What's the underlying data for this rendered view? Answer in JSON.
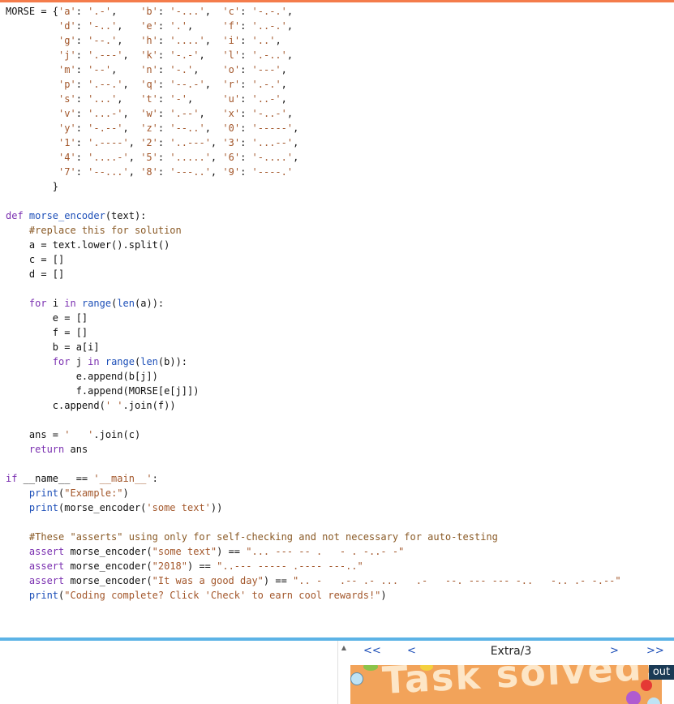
{
  "editor": {
    "lines": [
      [
        {
          "t": "MORSE = {",
          "c": ""
        },
        {
          "t": "'a'",
          "c": "str"
        },
        {
          "t": ": ",
          "c": ""
        },
        {
          "t": "'.-'",
          "c": "str"
        },
        {
          "t": ",    ",
          "c": ""
        },
        {
          "t": "'b'",
          "c": "str"
        },
        {
          "t": ": ",
          "c": ""
        },
        {
          "t": "'-...'",
          "c": "str"
        },
        {
          "t": ",  ",
          "c": ""
        },
        {
          "t": "'c'",
          "c": "str"
        },
        {
          "t": ": ",
          "c": ""
        },
        {
          "t": "'-.-.'",
          "c": "str"
        },
        {
          "t": ",",
          "c": ""
        }
      ],
      [
        {
          "t": "         ",
          "c": ""
        },
        {
          "t": "'d'",
          "c": "str"
        },
        {
          "t": ": ",
          "c": ""
        },
        {
          "t": "'-..'",
          "c": "str"
        },
        {
          "t": ",   ",
          "c": ""
        },
        {
          "t": "'e'",
          "c": "str"
        },
        {
          "t": ": ",
          "c": ""
        },
        {
          "t": "'.'",
          "c": "str"
        },
        {
          "t": ",     ",
          "c": ""
        },
        {
          "t": "'f'",
          "c": "str"
        },
        {
          "t": ": ",
          "c": ""
        },
        {
          "t": "'..-.'",
          "c": "str"
        },
        {
          "t": ",",
          "c": ""
        }
      ],
      [
        {
          "t": "         ",
          "c": ""
        },
        {
          "t": "'g'",
          "c": "str"
        },
        {
          "t": ": ",
          "c": ""
        },
        {
          "t": "'--.'",
          "c": "str"
        },
        {
          "t": ",   ",
          "c": ""
        },
        {
          "t": "'h'",
          "c": "str"
        },
        {
          "t": ": ",
          "c": ""
        },
        {
          "t": "'....'",
          "c": "str"
        },
        {
          "t": ",  ",
          "c": ""
        },
        {
          "t": "'i'",
          "c": "str"
        },
        {
          "t": ": ",
          "c": ""
        },
        {
          "t": "'..'",
          "c": "str"
        },
        {
          "t": ",",
          "c": ""
        }
      ],
      [
        {
          "t": "         ",
          "c": ""
        },
        {
          "t": "'j'",
          "c": "str"
        },
        {
          "t": ": ",
          "c": ""
        },
        {
          "t": "'.---'",
          "c": "str"
        },
        {
          "t": ",  ",
          "c": ""
        },
        {
          "t": "'k'",
          "c": "str"
        },
        {
          "t": ": ",
          "c": ""
        },
        {
          "t": "'-.-'",
          "c": "str"
        },
        {
          "t": ",   ",
          "c": ""
        },
        {
          "t": "'l'",
          "c": "str"
        },
        {
          "t": ": ",
          "c": ""
        },
        {
          "t": "'.-..'",
          "c": "str"
        },
        {
          "t": ",",
          "c": ""
        }
      ],
      [
        {
          "t": "         ",
          "c": ""
        },
        {
          "t": "'m'",
          "c": "str"
        },
        {
          "t": ": ",
          "c": ""
        },
        {
          "t": "'--'",
          "c": "str"
        },
        {
          "t": ",    ",
          "c": ""
        },
        {
          "t": "'n'",
          "c": "str"
        },
        {
          "t": ": ",
          "c": ""
        },
        {
          "t": "'-.'",
          "c": "str"
        },
        {
          "t": ",    ",
          "c": ""
        },
        {
          "t": "'o'",
          "c": "str"
        },
        {
          "t": ": ",
          "c": ""
        },
        {
          "t": "'---'",
          "c": "str"
        },
        {
          "t": ",",
          "c": ""
        }
      ],
      [
        {
          "t": "         ",
          "c": ""
        },
        {
          "t": "'p'",
          "c": "str"
        },
        {
          "t": ": ",
          "c": ""
        },
        {
          "t": "'.--.'",
          "c": "str"
        },
        {
          "t": ",  ",
          "c": ""
        },
        {
          "t": "'q'",
          "c": "str"
        },
        {
          "t": ": ",
          "c": ""
        },
        {
          "t": "'--.-'",
          "c": "str"
        },
        {
          "t": ",  ",
          "c": ""
        },
        {
          "t": "'r'",
          "c": "str"
        },
        {
          "t": ": ",
          "c": ""
        },
        {
          "t": "'.-.'",
          "c": "str"
        },
        {
          "t": ",",
          "c": ""
        }
      ],
      [
        {
          "t": "         ",
          "c": ""
        },
        {
          "t": "'s'",
          "c": "str"
        },
        {
          "t": ": ",
          "c": ""
        },
        {
          "t": "'...'",
          "c": "str"
        },
        {
          "t": ",   ",
          "c": ""
        },
        {
          "t": "'t'",
          "c": "str"
        },
        {
          "t": ": ",
          "c": ""
        },
        {
          "t": "'-'",
          "c": "str"
        },
        {
          "t": ",     ",
          "c": ""
        },
        {
          "t": "'u'",
          "c": "str"
        },
        {
          "t": ": ",
          "c": ""
        },
        {
          "t": "'..-'",
          "c": "str"
        },
        {
          "t": ",",
          "c": ""
        }
      ],
      [
        {
          "t": "         ",
          "c": ""
        },
        {
          "t": "'v'",
          "c": "str"
        },
        {
          "t": ": ",
          "c": ""
        },
        {
          "t": "'...-'",
          "c": "str"
        },
        {
          "t": ",  ",
          "c": ""
        },
        {
          "t": "'w'",
          "c": "str"
        },
        {
          "t": ": ",
          "c": ""
        },
        {
          "t": "'.--'",
          "c": "str"
        },
        {
          "t": ",   ",
          "c": ""
        },
        {
          "t": "'x'",
          "c": "str"
        },
        {
          "t": ": ",
          "c": ""
        },
        {
          "t": "'-..-'",
          "c": "str"
        },
        {
          "t": ",",
          "c": ""
        }
      ],
      [
        {
          "t": "         ",
          "c": ""
        },
        {
          "t": "'y'",
          "c": "str"
        },
        {
          "t": ": ",
          "c": ""
        },
        {
          "t": "'-.--'",
          "c": "str"
        },
        {
          "t": ",  ",
          "c": ""
        },
        {
          "t": "'z'",
          "c": "str"
        },
        {
          "t": ": ",
          "c": ""
        },
        {
          "t": "'--..'",
          "c": "str"
        },
        {
          "t": ",  ",
          "c": ""
        },
        {
          "t": "'0'",
          "c": "str"
        },
        {
          "t": ": ",
          "c": ""
        },
        {
          "t": "'-----'",
          "c": "str"
        },
        {
          "t": ",",
          "c": ""
        }
      ],
      [
        {
          "t": "         ",
          "c": ""
        },
        {
          "t": "'1'",
          "c": "str"
        },
        {
          "t": ": ",
          "c": ""
        },
        {
          "t": "'.----'",
          "c": "str"
        },
        {
          "t": ", ",
          "c": ""
        },
        {
          "t": "'2'",
          "c": "str"
        },
        {
          "t": ": ",
          "c": ""
        },
        {
          "t": "'..---'",
          "c": "str"
        },
        {
          "t": ", ",
          "c": ""
        },
        {
          "t": "'3'",
          "c": "str"
        },
        {
          "t": ": ",
          "c": ""
        },
        {
          "t": "'...--'",
          "c": "str"
        },
        {
          "t": ",",
          "c": ""
        }
      ],
      [
        {
          "t": "         ",
          "c": ""
        },
        {
          "t": "'4'",
          "c": "str"
        },
        {
          "t": ": ",
          "c": ""
        },
        {
          "t": "'....-'",
          "c": "str"
        },
        {
          "t": ", ",
          "c": ""
        },
        {
          "t": "'5'",
          "c": "str"
        },
        {
          "t": ": ",
          "c": ""
        },
        {
          "t": "'.....'",
          "c": "str"
        },
        {
          "t": ", ",
          "c": ""
        },
        {
          "t": "'6'",
          "c": "str"
        },
        {
          "t": ": ",
          "c": ""
        },
        {
          "t": "'-....'",
          "c": "str"
        },
        {
          "t": ",",
          "c": ""
        }
      ],
      [
        {
          "t": "         ",
          "c": ""
        },
        {
          "t": "'7'",
          "c": "str"
        },
        {
          "t": ": ",
          "c": ""
        },
        {
          "t": "'--...'",
          "c": "str"
        },
        {
          "t": ", ",
          "c": ""
        },
        {
          "t": "'8'",
          "c": "str"
        },
        {
          "t": ": ",
          "c": ""
        },
        {
          "t": "'---..'",
          "c": "str"
        },
        {
          "t": ", ",
          "c": ""
        },
        {
          "t": "'9'",
          "c": "str"
        },
        {
          "t": ": ",
          "c": ""
        },
        {
          "t": "'----.'",
          "c": "str"
        }
      ],
      [
        {
          "t": "        }",
          "c": ""
        }
      ],
      [],
      [
        {
          "t": "def ",
          "c": "kw"
        },
        {
          "t": "morse_encoder",
          "c": "fn"
        },
        {
          "t": "(text):",
          "c": ""
        }
      ],
      [
        {
          "t": "    ",
          "c": ""
        },
        {
          "t": "#replace this for solution",
          "c": "cm"
        }
      ],
      [
        {
          "t": "    a = text.lower().split()",
          "c": ""
        }
      ],
      [
        {
          "t": "    c = []",
          "c": ""
        }
      ],
      [
        {
          "t": "    d = []",
          "c": ""
        }
      ],
      [],
      [
        {
          "t": "    ",
          "c": ""
        },
        {
          "t": "for",
          "c": "kw"
        },
        {
          "t": " i ",
          "c": ""
        },
        {
          "t": "in",
          "c": "kw"
        },
        {
          "t": " ",
          "c": ""
        },
        {
          "t": "range",
          "c": "fn"
        },
        {
          "t": "(",
          "c": ""
        },
        {
          "t": "len",
          "c": "fn"
        },
        {
          "t": "(a)):",
          "c": ""
        }
      ],
      [
        {
          "t": "        e = []",
          "c": ""
        }
      ],
      [
        {
          "t": "        f = []",
          "c": ""
        }
      ],
      [
        {
          "t": "        b = a[i]",
          "c": ""
        }
      ],
      [
        {
          "t": "        ",
          "c": ""
        },
        {
          "t": "for",
          "c": "kw"
        },
        {
          "t": " j ",
          "c": ""
        },
        {
          "t": "in",
          "c": "kw"
        },
        {
          "t": " ",
          "c": ""
        },
        {
          "t": "range",
          "c": "fn"
        },
        {
          "t": "(",
          "c": ""
        },
        {
          "t": "len",
          "c": "fn"
        },
        {
          "t": "(b)):",
          "c": ""
        }
      ],
      [
        {
          "t": "            e.append(b[j])",
          "c": ""
        }
      ],
      [
        {
          "t": "            f.append(MORSE[e[j]])",
          "c": ""
        }
      ],
      [
        {
          "t": "        c.append(",
          "c": ""
        },
        {
          "t": "' '",
          "c": "str"
        },
        {
          "t": ".join(f))",
          "c": ""
        }
      ],
      [],
      [
        {
          "t": "    ans = ",
          "c": ""
        },
        {
          "t": "'   '",
          "c": "str"
        },
        {
          "t": ".join(c)",
          "c": ""
        }
      ],
      [
        {
          "t": "    ",
          "c": ""
        },
        {
          "t": "return",
          "c": "kw"
        },
        {
          "t": " ans",
          "c": ""
        }
      ],
      [],
      [
        {
          "t": "if",
          "c": "kw"
        },
        {
          "t": " __name__ == ",
          "c": ""
        },
        {
          "t": "'__main__'",
          "c": "str"
        },
        {
          "t": ":",
          "c": ""
        }
      ],
      [
        {
          "t": "    ",
          "c": ""
        },
        {
          "t": "print",
          "c": "fn"
        },
        {
          "t": "(",
          "c": ""
        },
        {
          "t": "\"Example:\"",
          "c": "str"
        },
        {
          "t": ")",
          "c": ""
        }
      ],
      [
        {
          "t": "    ",
          "c": ""
        },
        {
          "t": "print",
          "c": "fn"
        },
        {
          "t": "(morse_encoder(",
          "c": ""
        },
        {
          "t": "'some text'",
          "c": "str"
        },
        {
          "t": "))",
          "c": ""
        }
      ],
      [],
      [
        {
          "t": "    ",
          "c": ""
        },
        {
          "t": "#These \"asserts\" using only for self-checking and not necessary for auto-testing",
          "c": "cm"
        }
      ],
      [
        {
          "t": "    ",
          "c": ""
        },
        {
          "t": "assert",
          "c": "kw"
        },
        {
          "t": " morse_encoder(",
          "c": ""
        },
        {
          "t": "\"some text\"",
          "c": "str"
        },
        {
          "t": ") == ",
          "c": ""
        },
        {
          "t": "\"... --- -- .   - . -..- -\"",
          "c": "str"
        }
      ],
      [
        {
          "t": "    ",
          "c": ""
        },
        {
          "t": "assert",
          "c": "kw"
        },
        {
          "t": " morse_encoder(",
          "c": ""
        },
        {
          "t": "\"2018\"",
          "c": "str"
        },
        {
          "t": ") == ",
          "c": ""
        },
        {
          "t": "\"..--- ----- .---- ---..\"",
          "c": "str"
        }
      ],
      [
        {
          "t": "    ",
          "c": ""
        },
        {
          "t": "assert",
          "c": "kw"
        },
        {
          "t": " morse_encoder(",
          "c": ""
        },
        {
          "t": "\"It was a good day\"",
          "c": "str"
        },
        {
          "t": ") == ",
          "c": ""
        },
        {
          "t": "\".. -   .-- .- ...   .-   --. --- --- -..   -.. .- -.--\"",
          "c": "str"
        }
      ],
      [
        {
          "t": "    ",
          "c": ""
        },
        {
          "t": "print",
          "c": "fn"
        },
        {
          "t": "(",
          "c": ""
        },
        {
          "t": "\"Coding complete? Click 'Check' to earn cool rewards!\"",
          "c": "str"
        },
        {
          "t": ")",
          "c": ""
        }
      ]
    ]
  },
  "nav": {
    "first": "<<",
    "prev": "<",
    "title": "Extra/3",
    "next": ">",
    "last": ">>"
  },
  "result": {
    "banner": "Task solved!",
    "out_label": "out"
  },
  "colors": {
    "accent_top": "#f47c4b",
    "divider": "#5cb3e6",
    "banner_bg": "#f2a35a",
    "keyword": "#7a2fb0",
    "string": "#a3572b"
  }
}
